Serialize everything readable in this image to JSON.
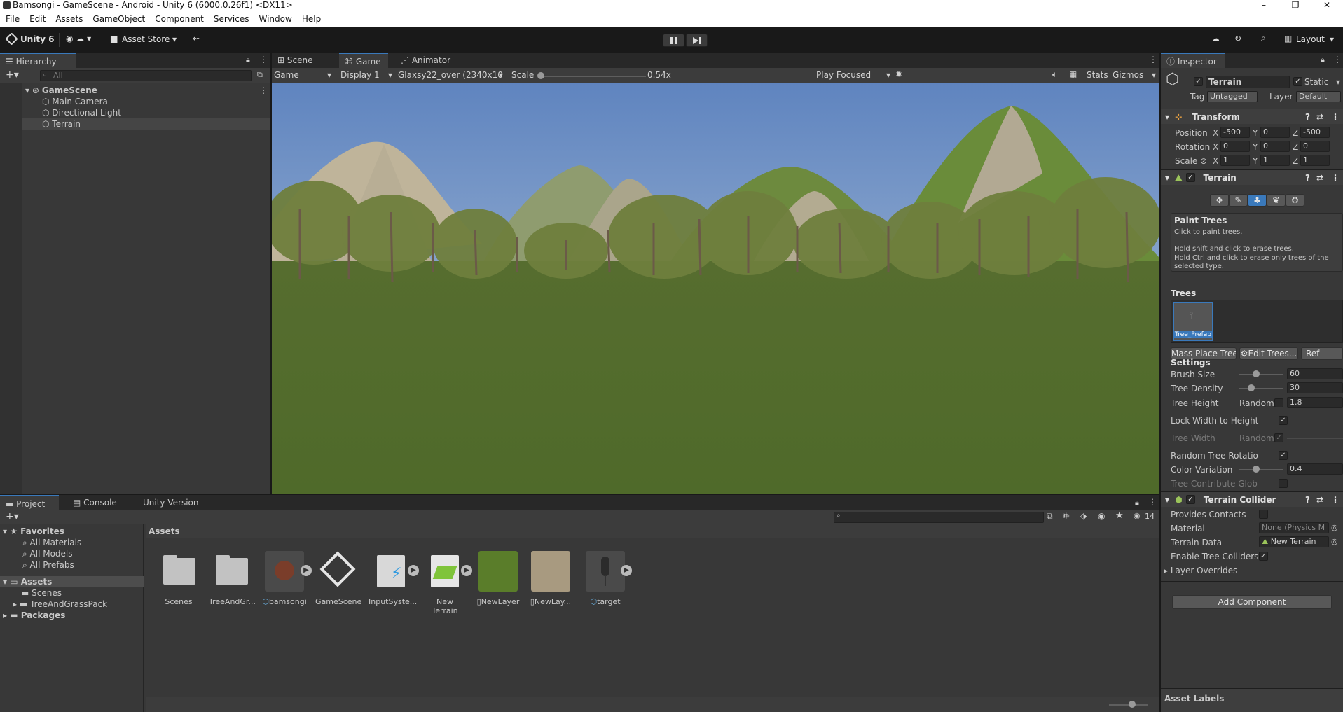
{
  "window": {
    "title": "Bamsongi - GameScene - Android - Unity 6 (6000.0.26f1) <DX11>"
  },
  "menu": [
    "File",
    "Edit",
    "Assets",
    "GameObject",
    "Component",
    "Services",
    "Window",
    "Help"
  ],
  "toolbar": {
    "unity_label": "Unity 6",
    "asset_store": "Asset Store",
    "layout": "Layout"
  },
  "hierarchy": {
    "tab": "Hierarchy",
    "search_placeholder": "All",
    "scene": "GameScene",
    "items": [
      "Main Camera",
      "Directional Light",
      "Terrain"
    ],
    "selected": "Terrain"
  },
  "view_tabs": [
    "Scene",
    "Game",
    "Animator"
  ],
  "game": {
    "mode": "Game",
    "display": "Display 1",
    "resolution": "Glaxsy22_over (2340x10",
    "scale_label": "Scale",
    "scale_value": "0.54x",
    "play_focused": "Play Focused",
    "stats": "Stats",
    "gizmos": "Gizmos"
  },
  "inspector": {
    "tab": "Inspector",
    "object_name": "Terrain",
    "static_label": "Static",
    "tag_label": "Tag",
    "tag_value": "Untagged",
    "layer_label": "Layer",
    "layer_value": "Default",
    "transform": {
      "title": "Transform",
      "position": {
        "label": "Position",
        "x": "-500",
        "y": "0",
        "z": "-500"
      },
      "rotation": {
        "label": "Rotation",
        "x": "0",
        "y": "0",
        "z": "0"
      },
      "scale": {
        "label": "Scale",
        "x": "1",
        "y": "1",
        "z": "1"
      }
    },
    "terrain": {
      "title": "Terrain",
      "paint_title": "Paint Trees",
      "help1": "Click to paint trees.",
      "help2": "Hold shift and click to erase trees.",
      "help3": "Hold Ctrl and click to erase only trees of the selected type.",
      "trees_label": "Trees",
      "tree_prefab": "Tree_Prefab",
      "mass_place": "Mass Place Trees",
      "edit_trees": "Edit Trees...",
      "refresh": "Ref",
      "settings_label": "Settings",
      "brush_size": {
        "label": "Brush Size",
        "value": "60",
        "fraction": 0.4
      },
      "tree_density": {
        "label": "Tree Density",
        "value": "30",
        "fraction": 0.28
      },
      "tree_height": {
        "label": "Tree Height",
        "random": "Random?",
        "value": "1.8"
      },
      "lock_width": "Lock Width to Height",
      "tree_width": {
        "label": "Tree Width",
        "random": "Random?"
      },
      "random_rotation": "Random Tree Rotatio",
      "color_variation": {
        "label": "Color Variation",
        "value": "0.4",
        "fraction": 0.4
      },
      "contribute": "Tree Contribute Glob"
    },
    "collider": {
      "title": "Terrain Collider",
      "provides_contacts": "Provides Contacts",
      "material_label": "Material",
      "material_value": "None (Physics M",
      "terrain_data_label": "Terrain Data",
      "terrain_data_value": "New Terrain",
      "enable_tree": "Enable Tree Colliders",
      "layer_overrides": "Layer Overrides"
    },
    "add_component": "Add Component",
    "asset_labels": "Asset Labels"
  },
  "project": {
    "tabs": [
      "Project",
      "Console",
      "Unity Version Control"
    ],
    "count": "14",
    "favorites": {
      "label": "Favorites",
      "items": [
        "All Materials",
        "All Models",
        "All Prefabs"
      ]
    },
    "assets_label": "Assets",
    "asset_tree": [
      "Scenes",
      "TreeAndGrassPack"
    ],
    "packages": "Packages",
    "breadcrumb": "Assets",
    "items": [
      {
        "name": "Scenes",
        "kind": "folder"
      },
      {
        "name": "TreeAndGr...",
        "kind": "folder"
      },
      {
        "name": "bamsongi",
        "kind": "prefab"
      },
      {
        "name": "GameScene",
        "kind": "scene"
      },
      {
        "name": "InputSyste...",
        "kind": "input"
      },
      {
        "name": "New Terrain",
        "kind": "terrain"
      },
      {
        "name": "NewLayer",
        "kind": "layer"
      },
      {
        "name": "NewLay...",
        "kind": "layer"
      },
      {
        "name": "target",
        "kind": "prefab"
      }
    ]
  },
  "colors": {
    "accent": "#3a79bb",
    "panel": "#383838",
    "bg": "#191919"
  }
}
